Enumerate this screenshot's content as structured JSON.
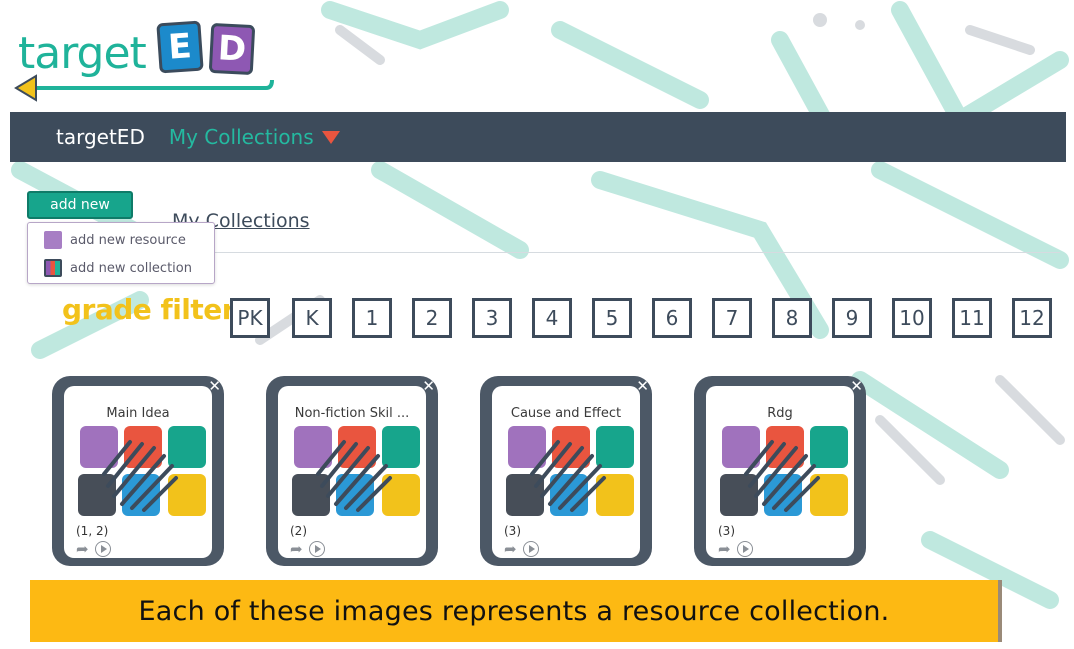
{
  "logo": {
    "word": "target",
    "letter_e": "E",
    "letter_d": "D"
  },
  "navbar": {
    "brand": "targetED",
    "collections": "My Collections"
  },
  "add_new": {
    "button_label": "add new",
    "items": [
      {
        "label": "add new resource",
        "icon": "resource-icon"
      },
      {
        "label": "add new collection",
        "icon": "collection-icon"
      }
    ]
  },
  "page_heading": "My Collections",
  "grade_filter": {
    "label": "grade filter",
    "grades": [
      "PK",
      "K",
      "1",
      "2",
      "3",
      "4",
      "5",
      "6",
      "7",
      "8",
      "9",
      "10",
      "11",
      "12"
    ]
  },
  "collections": [
    {
      "title": "Main Idea",
      "grades": "(1, 2)"
    },
    {
      "title": "Non-fiction Skil ...",
      "grades": "(2)"
    },
    {
      "title": "Cause and Effect",
      "grades": "(3)"
    },
    {
      "title": "Rdg",
      "grades": "(3)"
    }
  ],
  "caption": "Each of these images represents a resource collection.",
  "colors": {
    "navbar": "#3d4b5b",
    "accent_teal": "#17a58c",
    "caret_red": "#e9553f",
    "grade_yellow": "#f2c21b",
    "caption_bg": "#fdb913"
  }
}
